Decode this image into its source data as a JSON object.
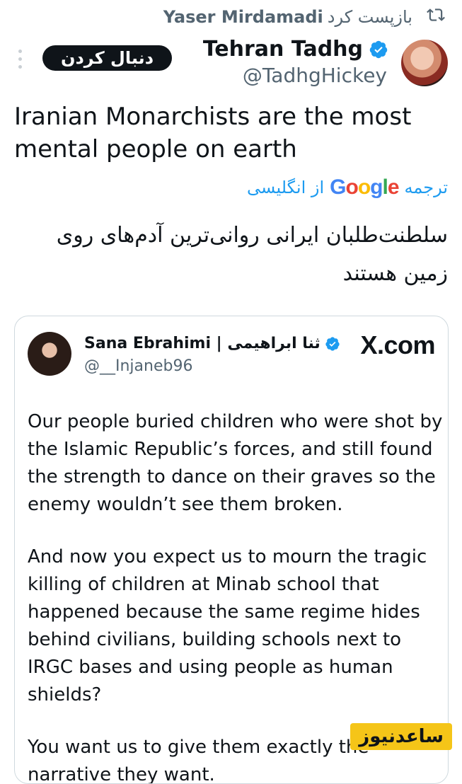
{
  "repost": {
    "user": "Yaser Mirdamadi",
    "action": "بازپست کرد"
  },
  "author": {
    "name": "Tehran Tadhg",
    "handle": "@TadhgHickey"
  },
  "follow_button": "دنبال کردن",
  "tweet": {
    "text": "Iranian Monarchists are the most mental people on earth"
  },
  "translation": {
    "prefix": "ترجمه",
    "suffix": "از انگلیسی",
    "google": "Google",
    "text": "سلطنت‌طلبان ایرانی روانی‌ترین آدم‌های روی زمین هستند"
  },
  "quote": {
    "name": "Sana Ebrahimi | ثنا ابراهیمی",
    "handle": "@__Injaneb96",
    "site": "X.com",
    "paragraphs": [
      "Our people buried children who were shot by the Islamic Republic’s forces, and still found the strength to dance on their graves so the enemy wouldn’t see them broken.",
      "And now you expect us to mourn the tragic killing of children at Minab school that happened because the same regime hides behind civilians, building schools next to IRGC bases and using people as human shields?",
      "You want us to give them exactly the narrative they want."
    ]
  },
  "watermark": "ساعدنیوز",
  "colors": {
    "accent": "#1d9bf0",
    "text": "#0f1419",
    "muted": "#536471"
  }
}
